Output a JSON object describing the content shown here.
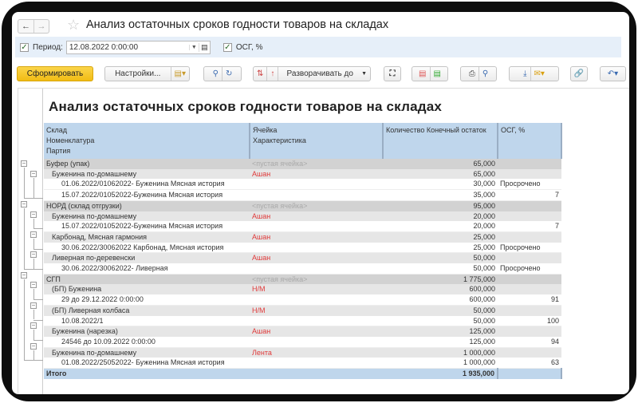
{
  "window": {
    "title": "Анализ остаточных сроков годности товаров на складах",
    "back_icon": "arrow-left",
    "forward_icon": "arrow-right",
    "favorite_icon": "star"
  },
  "filter": {
    "period_label": "Период:",
    "period_value": "12.08.2022  0:00:00",
    "period_checked": true,
    "osg_label": "ОСГ, %",
    "osg_checked": true
  },
  "toolbar": {
    "generate": "Сформировать",
    "settings": "Настройки...",
    "expand_to": "Разворачивать до"
  },
  "report": {
    "title": "Анализ остаточных сроков годности товаров на складах",
    "headers": {
      "col1": [
        "Склад",
        "Номенклатура",
        "Партия"
      ],
      "col2": [
        "Ячейка",
        "Характеристика"
      ],
      "col3": "Количество Конечный остаток",
      "col4": "ОСГ, %"
    },
    "rows": [
      {
        "level": 0,
        "name": "Буфер (упак)",
        "cell": "<пустая ячейка>",
        "qty": "65,000",
        "osg": ""
      },
      {
        "level": 1,
        "name": "Буженина по-домашнему",
        "cell": "Ашан",
        "qty": "65,000",
        "osg": ""
      },
      {
        "level": 2,
        "name": "01.06.2022/01062022- Буженина Мясная история",
        "cell": "",
        "qty": "30,000",
        "osg": "Просрочено"
      },
      {
        "level": 2,
        "name": "15.07.2022/01052022-Буженина Мясная история",
        "cell": "",
        "qty": "35,000",
        "osg": "7"
      },
      {
        "level": 0,
        "name": "НОРД (склад отгрузки)",
        "cell": "<пустая ячейка>",
        "qty": "95,000",
        "osg": ""
      },
      {
        "level": 1,
        "name": "Буженина по-домашнему",
        "cell": "Ашан",
        "qty": "20,000",
        "osg": ""
      },
      {
        "level": 2,
        "name": "15.07.2022/01052022-Буженина Мясная история",
        "cell": "",
        "qty": "20,000",
        "osg": "7"
      },
      {
        "level": 1,
        "name": "Карбонад, Мясная гармония",
        "cell": "Ашан",
        "qty": "25,000",
        "osg": ""
      },
      {
        "level": 2,
        "name": "30.06.2022/30062022 Карбонад, Мясная история",
        "cell": "",
        "qty": "25,000",
        "osg": "Просрочено"
      },
      {
        "level": 1,
        "name": "Ливерная по-деревенски",
        "cell": "Ашан",
        "qty": "50,000",
        "osg": ""
      },
      {
        "level": 2,
        "name": "30.06.2022/30062022- Ливерная",
        "cell": "",
        "qty": "50,000",
        "osg": "Просрочено"
      },
      {
        "level": 0,
        "name": "СГП",
        "cell": "<пустая ячейка>",
        "qty": "1 775,000",
        "osg": ""
      },
      {
        "level": 1,
        "name": "(БП) Буженина",
        "cell": "Н/М",
        "qty": "600,000",
        "osg": ""
      },
      {
        "level": 2,
        "name": "29 до 29.12.2022 0:00:00",
        "cell": "",
        "qty": "600,000",
        "osg": "91"
      },
      {
        "level": 1,
        "name": "(БП) Ливерная колбаса",
        "cell": "Н/М",
        "qty": "50,000",
        "osg": ""
      },
      {
        "level": 2,
        "name": "10.08.2022/1",
        "cell": "",
        "qty": "50,000",
        "osg": "100"
      },
      {
        "level": 1,
        "name": "Буженина (нарезка)",
        "cell": "Ашан",
        "qty": "125,000",
        "osg": ""
      },
      {
        "level": 2,
        "name": "24546 до 10.09.2022 0:00:00",
        "cell": "",
        "qty": "125,000",
        "osg": "94"
      },
      {
        "level": 1,
        "name": "Буженина по-домашнему",
        "cell": "Лента",
        "qty": "1 000,000",
        "osg": ""
      },
      {
        "level": 2,
        "name": "01.08.2022/25052022- Буженина Мясная история",
        "cell": "",
        "qty": "1 000,000",
        "osg": "63"
      }
    ],
    "total": {
      "label": "Итого",
      "qty": "1 935,000"
    }
  },
  "colors": {
    "accent_button": "#f1bc14",
    "header_bg": "#bfd6ec",
    "cell_red": "#e03a3a"
  }
}
